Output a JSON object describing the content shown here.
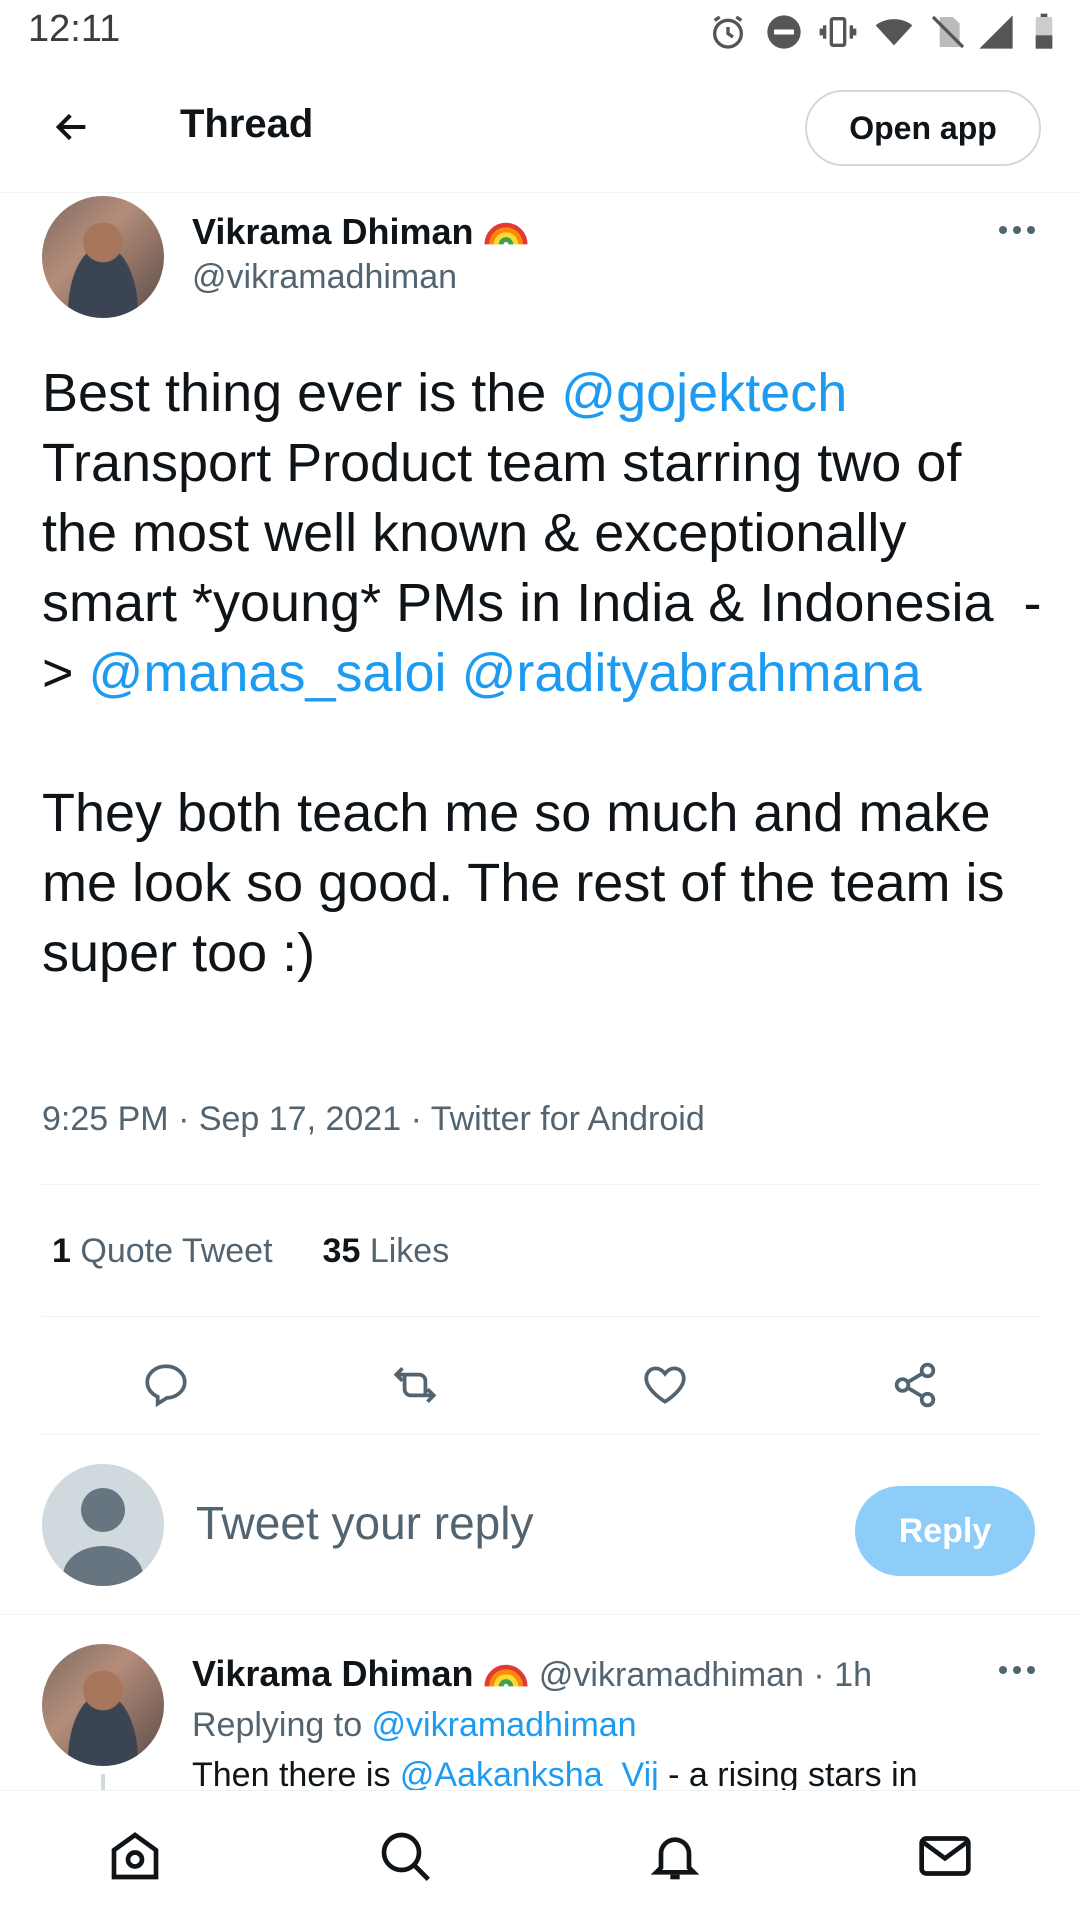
{
  "status_bar": {
    "time": "12:11"
  },
  "header": {
    "title": "Thread",
    "open_app_label": "Open app"
  },
  "tweet": {
    "author_name": "Vikrama Dhiman",
    "author_handle": "@vikramadhiman",
    "text_parts": {
      "p1": "Best thing ever is the ",
      "m1": "@gojektech",
      "p2": "\nTransport Product team starring two of the most well known & exceptionally smart *young* PMs in India & Indonesia  -> ",
      "m2": "@manas_saloi",
      "m3": "@radityabrahmana",
      "p3": "\n\nThey both teach me so much and make me look so good. The rest of the team is super too :)"
    },
    "meta": "9:25 PM · Sep 17, 2021 · Twitter for Android",
    "quote_count": "1",
    "quote_label": "Quote Tweet",
    "likes_count": "35",
    "likes_label": "Likes"
  },
  "reply_box": {
    "placeholder": "Tweet your reply",
    "reply_label": "Reply"
  },
  "reply_tweet": {
    "author_name": "Vikrama Dhiman",
    "author_handle": "@vikramadhiman",
    "time": "· 1h",
    "replying_prefix": "Replying to ",
    "replying_handle": "@vikramadhiman",
    "text_prefix": "Then there is ",
    "text_mention": "@Aakanksha_Vij",
    "text_rest": " - a rising stars in"
  },
  "colors": {
    "accent": "#1d9bf0",
    "reply_button": "#8ecdf8"
  }
}
